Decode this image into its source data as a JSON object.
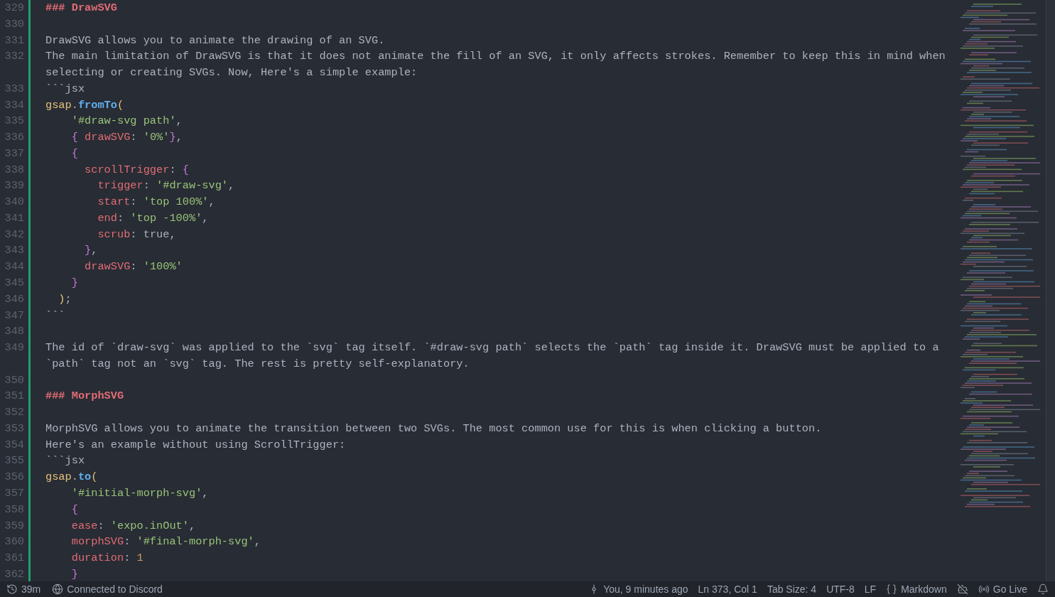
{
  "editor": {
    "lines": [
      {
        "number": "329",
        "added": true,
        "rows": [
          [
            {
              "kind": "heading",
              "text": "### DrawSVG"
            }
          ]
        ]
      },
      {
        "number": "330",
        "added": true
      },
      {
        "number": "331",
        "added": true,
        "rows": [
          [
            {
              "kind": "plain",
              "text": "DrawSVG allows you to animate the drawing of an SVG."
            }
          ]
        ]
      },
      {
        "number": "332",
        "added": true,
        "rows": [
          [
            {
              "kind": "plain",
              "text": "The main limitation of DrawSVG is that it does not animate the fill of an SVG, it only affects strokes. Remember to keep this in mind when"
            }
          ],
          [
            {
              "kind": "plain",
              "text": "selecting or creating SVGs. Now, Here's a simple example:"
            }
          ]
        ]
      },
      {
        "number": "333",
        "added": true,
        "rows": [
          [
            {
              "kind": "plain",
              "text": "```jsx"
            }
          ]
        ]
      },
      {
        "number": "334",
        "added": true,
        "rows": [
          [
            {
              "kind": "object",
              "text": "gsap"
            },
            {
              "kind": "plain",
              "text": "."
            },
            {
              "kind": "function",
              "text": "fromTo"
            },
            {
              "kind": "paren",
              "text": "("
            }
          ]
        ]
      },
      {
        "number": "335",
        "added": true,
        "rows": [
          [
            {
              "kind": "plain",
              "text": "    "
            },
            {
              "kind": "string",
              "text": "'#draw-svg path'"
            },
            {
              "kind": "plain",
              "text": ","
            }
          ]
        ]
      },
      {
        "number": "336",
        "added": true,
        "rows": [
          [
            {
              "kind": "plain",
              "text": "    "
            },
            {
              "kind": "bracket",
              "text": "{"
            },
            {
              "kind": "plain",
              "text": " "
            },
            {
              "kind": "property",
              "text": "drawSVG"
            },
            {
              "kind": "plain",
              "text": ": "
            },
            {
              "kind": "string",
              "text": "'0%'"
            },
            {
              "kind": "bracket",
              "text": "}"
            },
            {
              "kind": "plain",
              "text": ","
            }
          ]
        ]
      },
      {
        "number": "337",
        "added": true,
        "rows": [
          [
            {
              "kind": "plain",
              "text": "    "
            },
            {
              "kind": "bracket",
              "text": "{"
            }
          ]
        ]
      },
      {
        "number": "338",
        "added": true,
        "rows": [
          [
            {
              "kind": "plain",
              "text": "      "
            },
            {
              "kind": "property",
              "text": "scrollTrigger"
            },
            {
              "kind": "plain",
              "text": ": "
            },
            {
              "kind": "bracket",
              "text": "{"
            }
          ]
        ]
      },
      {
        "number": "339",
        "added": true,
        "rows": [
          [
            {
              "kind": "plain",
              "text": "        "
            },
            {
              "kind": "property",
              "text": "trigger"
            },
            {
              "kind": "plain",
              "text": ": "
            },
            {
              "kind": "string",
              "text": "'#draw-svg'"
            },
            {
              "kind": "plain",
              "text": ","
            }
          ]
        ]
      },
      {
        "number": "340",
        "added": true,
        "rows": [
          [
            {
              "kind": "plain",
              "text": "        "
            },
            {
              "kind": "property",
              "text": "start"
            },
            {
              "kind": "plain",
              "text": ": "
            },
            {
              "kind": "string",
              "text": "'top 100%'"
            },
            {
              "kind": "plain",
              "text": ","
            }
          ]
        ]
      },
      {
        "number": "341",
        "added": true,
        "rows": [
          [
            {
              "kind": "plain",
              "text": "        "
            },
            {
              "kind": "property",
              "text": "end"
            },
            {
              "kind": "plain",
              "text": ": "
            },
            {
              "kind": "string",
              "text": "'top -100%'"
            },
            {
              "kind": "plain",
              "text": ","
            }
          ]
        ]
      },
      {
        "number": "342",
        "added": true,
        "rows": [
          [
            {
              "kind": "plain",
              "text": "        "
            },
            {
              "kind": "property",
              "text": "scrub"
            },
            {
              "kind": "plain",
              "text": ": true,"
            }
          ]
        ]
      },
      {
        "number": "343",
        "added": true,
        "rows": [
          [
            {
              "kind": "plain",
              "text": "      "
            },
            {
              "kind": "bracket",
              "text": "}"
            },
            {
              "kind": "plain",
              "text": ","
            }
          ]
        ]
      },
      {
        "number": "344",
        "added": true,
        "rows": [
          [
            {
              "kind": "plain",
              "text": "      "
            },
            {
              "kind": "property",
              "text": "drawSVG"
            },
            {
              "kind": "plain",
              "text": ": "
            },
            {
              "kind": "string",
              "text": "'100%'"
            }
          ]
        ]
      },
      {
        "number": "345",
        "added": true,
        "rows": [
          [
            {
              "kind": "plain",
              "text": "    "
            },
            {
              "kind": "bracket",
              "text": "}"
            }
          ]
        ]
      },
      {
        "number": "346",
        "added": true,
        "rows": [
          [
            {
              "kind": "plain",
              "text": "  "
            },
            {
              "kind": "paren",
              "text": ")"
            },
            {
              "kind": "plain",
              "text": ";"
            }
          ]
        ]
      },
      {
        "number": "347",
        "added": true,
        "rows": [
          [
            {
              "kind": "plain",
              "text": "```"
            }
          ]
        ]
      },
      {
        "number": "348",
        "added": true
      },
      {
        "number": "349",
        "added": true,
        "rows": [
          [
            {
              "kind": "plain",
              "text": "The id of `draw-svg` was applied to the `svg` tag itself. `#draw-svg path` selects the `path` tag inside it. DrawSVG must be applied to a"
            }
          ],
          [
            {
              "kind": "plain",
              "text": "`path` tag not an `svg` tag. The rest is pretty self-explanatory."
            }
          ]
        ]
      },
      {
        "number": "350",
        "added": true
      },
      {
        "number": "351",
        "added": true,
        "rows": [
          [
            {
              "kind": "heading",
              "text": "### MorphSVG"
            }
          ]
        ]
      },
      {
        "number": "352",
        "added": true
      },
      {
        "number": "353",
        "added": true,
        "rows": [
          [
            {
              "kind": "plain",
              "text": "MorphSVG allows you to animate the transition between two SVGs. The most common use for this is when clicking a button."
            }
          ]
        ]
      },
      {
        "number": "354",
        "added": true,
        "rows": [
          [
            {
              "kind": "plain",
              "text": "Here's an example without using ScrollTrigger:"
            }
          ]
        ]
      },
      {
        "number": "355",
        "added": true,
        "rows": [
          [
            {
              "kind": "plain",
              "text": "```jsx"
            }
          ]
        ]
      },
      {
        "number": "356",
        "added": true,
        "rows": [
          [
            {
              "kind": "object",
              "text": "gsap"
            },
            {
              "kind": "plain",
              "text": "."
            },
            {
              "kind": "function",
              "text": "to"
            },
            {
              "kind": "paren",
              "text": "("
            }
          ]
        ]
      },
      {
        "number": "357",
        "added": true,
        "rows": [
          [
            {
              "kind": "plain",
              "text": "    "
            },
            {
              "kind": "string",
              "text": "'#initial-morph-svg'"
            },
            {
              "kind": "plain",
              "text": ","
            }
          ]
        ]
      },
      {
        "number": "358",
        "added": true,
        "rows": [
          [
            {
              "kind": "plain",
              "text": "    "
            },
            {
              "kind": "bracket",
              "text": "{"
            }
          ]
        ]
      },
      {
        "number": "359",
        "added": true,
        "rows": [
          [
            {
              "kind": "plain",
              "text": "    "
            },
            {
              "kind": "property",
              "text": "ease"
            },
            {
              "kind": "plain",
              "text": ": "
            },
            {
              "kind": "string",
              "text": "'expo.inOut'"
            },
            {
              "kind": "plain",
              "text": ","
            }
          ]
        ]
      },
      {
        "number": "360",
        "added": true,
        "rows": [
          [
            {
              "kind": "plain",
              "text": "    "
            },
            {
              "kind": "property",
              "text": "morphSVG"
            },
            {
              "kind": "plain",
              "text": ": "
            },
            {
              "kind": "string",
              "text": "'#final-morph-svg'"
            },
            {
              "kind": "plain",
              "text": ","
            }
          ]
        ]
      },
      {
        "number": "361",
        "added": true,
        "rows": [
          [
            {
              "kind": "plain",
              "text": "    "
            },
            {
              "kind": "property",
              "text": "duration"
            },
            {
              "kind": "plain",
              "text": ": "
            },
            {
              "kind": "number",
              "text": "1"
            }
          ]
        ]
      },
      {
        "number": "362",
        "added": true,
        "rows": [
          [
            {
              "kind": "plain",
              "text": "    "
            },
            {
              "kind": "bracket",
              "text": "}"
            }
          ]
        ]
      }
    ]
  },
  "status_bar": {
    "left": [
      {
        "kind": "history",
        "text": "39m"
      },
      {
        "kind": "globe",
        "text": "Connected to Discord"
      }
    ],
    "right": [
      {
        "kind": "commit",
        "text": "You, 9 minutes ago"
      },
      {
        "kind": "plain",
        "text": "Ln 373, Col 1"
      },
      {
        "kind": "plain",
        "text": "Tab Size: 4"
      },
      {
        "kind": "plain",
        "text": "UTF-8"
      },
      {
        "kind": "plain",
        "text": "LF"
      },
      {
        "kind": "braces",
        "text": "Markdown"
      },
      {
        "kind": "copilot"
      },
      {
        "kind": "broadcast",
        "text": "Go Live"
      },
      {
        "kind": "bell"
      }
    ]
  }
}
